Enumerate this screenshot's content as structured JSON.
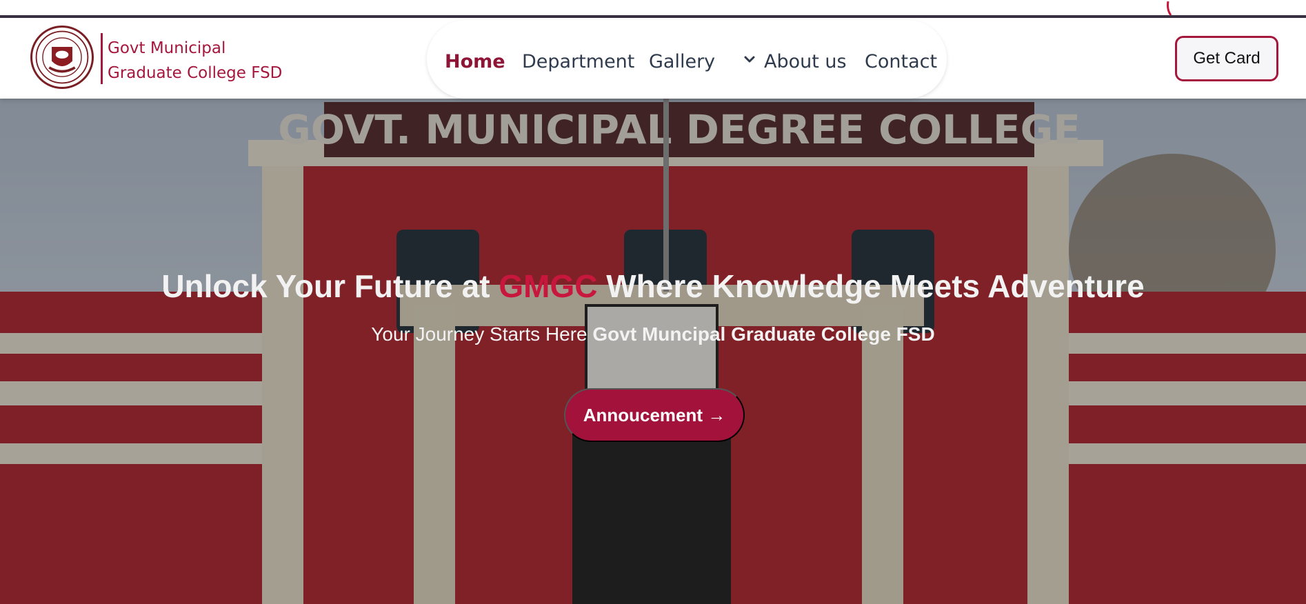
{
  "brand": {
    "line1": "Govt Municipal",
    "line2": "Graduate College FSD"
  },
  "nav": {
    "items": [
      {
        "label": "Home",
        "active": true
      },
      {
        "label": "Department"
      },
      {
        "label": "Gallery"
      },
      {
        "label": "About us",
        "icon": "chevron-down-icon"
      },
      {
        "label": "Contact"
      }
    ]
  },
  "header": {
    "cta_label": "Get Card"
  },
  "hero": {
    "building_sign": "GOVT. MUNICIPAL DEGREE COLLEGE",
    "title_prefix": "Unlock Your Future at ",
    "title_accent": "GMGC",
    "title_suffix": " Where Knowledge Meets Adventure",
    "subtitle_prefix": "Your Journey Starts Here ",
    "subtitle_bold": "Govt Muncipal Graduate College FSD",
    "cta_label": "Annoucement →"
  },
  "colors": {
    "brand": "#a5173d",
    "accent": "#c8173c",
    "cta": "#a3123a"
  }
}
